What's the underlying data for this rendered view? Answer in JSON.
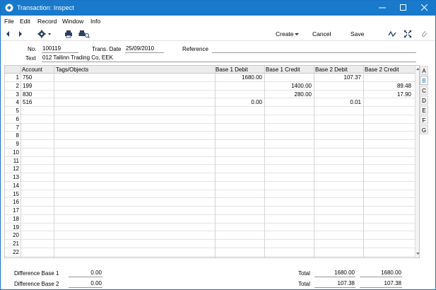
{
  "window": {
    "title": "Transaction: Inspect"
  },
  "menu": [
    "File",
    "Edit",
    "Record",
    "Window",
    "Info"
  ],
  "toolbar": {
    "create_label": "Create",
    "cancel_label": "Cancel",
    "save_label": "Save"
  },
  "header": {
    "no_label": "No.",
    "no_value": "100119",
    "date_label": "Trans. Date",
    "date_value": "25/09/2010",
    "ref_label": "Reference",
    "ref_value": "",
    "text_label": "Text",
    "text_value": "012 Tallinn Trading Co, EEK"
  },
  "grid": {
    "columns": [
      "Account",
      "Tags/Objects",
      "Base 1 Debit",
      "Base 1 Credit",
      "Base 2 Debit",
      "Base 2 Credit"
    ],
    "rows": [
      {
        "n": "1",
        "account": "750",
        "tags": "",
        "b1d": "1680.00",
        "b1c": "",
        "b2d": "107.37",
        "b2c": ""
      },
      {
        "n": "2",
        "account": "199",
        "tags": "",
        "b1d": "",
        "b1c": "1400.00",
        "b2d": "",
        "b2c": "89.48"
      },
      {
        "n": "3",
        "account": "830",
        "tags": "",
        "b1d": "",
        "b1c": "280.00",
        "b2d": "",
        "b2c": "17.90"
      },
      {
        "n": "4",
        "account": "516",
        "tags": "",
        "b1d": "0.00",
        "b1c": "",
        "b2d": "0.01",
        "b2c": ""
      },
      {
        "n": "5"
      },
      {
        "n": "6"
      },
      {
        "n": "7"
      },
      {
        "n": "8"
      },
      {
        "n": "9"
      },
      {
        "n": "10"
      },
      {
        "n": "11"
      },
      {
        "n": "12"
      },
      {
        "n": "13"
      },
      {
        "n": "14"
      },
      {
        "n": "15"
      },
      {
        "n": "16"
      },
      {
        "n": "17"
      },
      {
        "n": "18"
      },
      {
        "n": "19"
      },
      {
        "n": "20"
      },
      {
        "n": "21"
      },
      {
        "n": "22"
      }
    ]
  },
  "tabs": [
    "A",
    "B",
    "C",
    "D",
    "E",
    "F",
    "G"
  ],
  "active_tab": "B",
  "footer": {
    "diff1_label": "Difference Base 1",
    "diff1_value": "0.00",
    "diff2_label": "Difference Base 2",
    "diff2_value": "0.00",
    "total1_label": "Total",
    "total1_debit": "1680.00",
    "total1_credit": "1680.00",
    "total2_label": "Total",
    "total2_debit": "107.38",
    "total2_credit": "107.38"
  },
  "colors": {
    "titlebar": "#1979ca",
    "active_tab": "#1a6fc0"
  }
}
